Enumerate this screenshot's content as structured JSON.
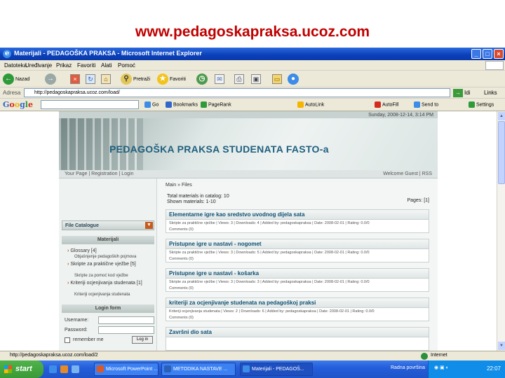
{
  "caption": "www.pedagoskapraksa.ucoz.com",
  "window": {
    "title": "Materijali - PEDAGOŠKA PRAKSA - Microsoft Internet Explorer",
    "btn_min": "_",
    "btn_max": "□",
    "btn_close": "×"
  },
  "menu": [
    "Datoteka",
    "Uređivanje",
    "Prikaz",
    "Favoriti",
    "Alati",
    "Pomoć"
  ],
  "toolbar": {
    "back": "Nazad",
    "search": "Pretraži",
    "favorites": "Favoriti"
  },
  "address": {
    "label": "Adresa",
    "value": "http://pedagoskapraksa.ucoz.com/load/",
    "go": "Idi",
    "links": "Links"
  },
  "google": {
    "logo": "Google",
    "items": [
      "Go",
      "Bookmarks",
      "PageRank",
      "AutoLink",
      "AutoFill",
      "Send to",
      "Settings"
    ]
  },
  "site": {
    "date": "Sunday, 2008-12-14, 3:14 PM",
    "title": "PEDAGOŠKA PRAKSA STUDENATA FASTO-a",
    "nav_left": "Your Page | Registration | Login",
    "nav_right": "Welcome Guest | RSS",
    "sidebar": {
      "catalogue": "File Catalogue",
      "materials_head": "Materijali",
      "items": [
        {
          "label": "Glossary [4]",
          "sub": "Objašnjenje pedagoških pojmova"
        },
        {
          "label": "Skripte za praktične vježbe [5]",
          "sub": "Skripte za pomoć kod vježbe"
        },
        {
          "label": "Kriteriji ocjenjivanja studenata [1]",
          "sub": "Kriteriji ocjenjivanja studenata"
        }
      ],
      "login_head": "Login form",
      "login_label": "Username:",
      "password_label": "Password:",
      "remember": "remember me",
      "login_btn": "Log in"
    },
    "main": {
      "crumb": "Main » Files",
      "total": "Total materials in catalog: 10",
      "shown": "Shown materials: 1-10",
      "pages": "Pages: [1]",
      "entries": [
        {
          "title": "Elementarne igre kao sredstvo uvodnog dijela sata",
          "meta1": "Skripte za praktične vježbe | Views: 3 | Downloads: 4 | Added by: pedagoskapraksa | Date: 2008-02-01 | Rating: 0.0/0",
          "meta2": "Comments (0)"
        },
        {
          "title": "Pristupne igre u nastavi - nogomet",
          "meta1": "Skripte za praktične vježbe | Views: 3 | Downloads: 5 | Added by: pedagoskapraksa | Date: 2008-02-01 | Rating: 0.0/0",
          "meta2": "Comments (0)"
        },
        {
          "title": "Pristupne igre u nastavi - košarka",
          "meta1": "Skripte za praktične vježbe | Views: 3 | Downloads: 3 | Added by: pedagoskapraksa | Date: 2008-02-01 | Rating: 0.0/0",
          "meta2": "Comments (0)"
        },
        {
          "title": "kriteriji za ocjenjivanje studenata na pedagoškoj praksi",
          "meta1": "Kriteriji ocjenjivanja studenata | Views: 2 | Downloads: 6 | Added by: pedagoskapraksa | Date: 2008-02-01 | Rating: 0.0/0",
          "meta2": "Comments (0)"
        },
        {
          "title": "Završni dio sata",
          "meta1": "",
          "meta2": ""
        }
      ]
    }
  },
  "status": {
    "url": "http://pedagoskapraksa.ucoz.com/load/2",
    "zone": "Internet"
  },
  "taskbar": {
    "start": "start",
    "tasks": [
      "Microsoft PowerPoint ...",
      "METODIKA NASTAVE ...",
      "Materijali - PEDAGOŠ..."
    ],
    "lang": "Radna površina",
    "clock": "22:07"
  },
  "colors": {
    "caption": "#c00000",
    "site_title": "#1f5f7e",
    "xp_blue": "#245edb",
    "start_green": "#3a9a36"
  }
}
